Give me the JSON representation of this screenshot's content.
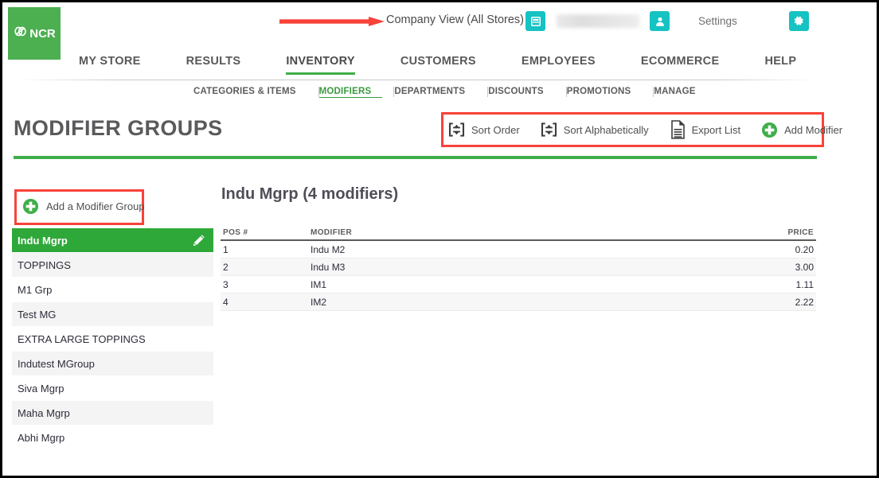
{
  "colors": {
    "brand_green": "#4caf50",
    "rule_green": "#3fae49",
    "selected_green": "#2fa83a",
    "teal": "#16c2c2",
    "annotation_red": "#f9423a",
    "text_gray": "#4a4a4a"
  },
  "header": {
    "logo_text": "NCR",
    "logo_icon": "ncr-link-logo-icon",
    "company_view": "Company View (All Stores)",
    "store_icon": "store-icon",
    "user_icon": "user-profile-icon",
    "user_name": "",
    "settings_label": "Settings",
    "gear_icon": "gear-icon",
    "arrow_annotation": "red-arrow-pointing-right"
  },
  "mainnav": {
    "items": [
      {
        "label": "MY STORE",
        "active": false
      },
      {
        "label": "RESULTS",
        "active": false
      },
      {
        "label": "INVENTORY",
        "active": true
      },
      {
        "label": "CUSTOMERS",
        "active": false
      },
      {
        "label": "EMPLOYEES",
        "active": false
      },
      {
        "label": "ECOMMERCE",
        "active": false
      },
      {
        "label": "HELP",
        "active": false
      }
    ]
  },
  "subnav": {
    "items": [
      {
        "label": "CATEGORIES & ITEMS",
        "active": false
      },
      {
        "label": "MODIFIERS",
        "active": true
      },
      {
        "label": "DEPARTMENTS",
        "active": false
      },
      {
        "label": "DISCOUNTS",
        "active": false
      },
      {
        "label": "PROMOTIONS",
        "active": false
      },
      {
        "label": "MANAGE",
        "active": false
      }
    ]
  },
  "page": {
    "title": "MODIFIER GROUPS"
  },
  "toolbar": {
    "buttons": [
      {
        "label": "Sort Order",
        "icon": "sort-order-icon"
      },
      {
        "label": "Sort Alphabetically",
        "icon": "sort-alphabetically-icon"
      },
      {
        "label": "Export List",
        "icon": "export-document-icon"
      },
      {
        "label": "Add Modifier",
        "icon": "plus-circle-icon"
      }
    ]
  },
  "sidebar": {
    "add_group_label": "Add a Modifier Group",
    "add_group_icon": "plus-circle-icon",
    "edit_icon": "pencil-edit-icon",
    "groups": [
      {
        "label": "Indu Mgrp",
        "selected": true
      },
      {
        "label": "TOPPINGS",
        "selected": false
      },
      {
        "label": "M1 Grp",
        "selected": false
      },
      {
        "label": "Test MG",
        "selected": false
      },
      {
        "label": "EXTRA LARGE TOPPINGS",
        "selected": false
      },
      {
        "label": "Indutest MGroup",
        "selected": false
      },
      {
        "label": "Siva Mgrp",
        "selected": false
      },
      {
        "label": "Maha Mgrp",
        "selected": false
      },
      {
        "label": "Abhi Mgrp",
        "selected": false
      }
    ]
  },
  "content": {
    "title": "Indu Mgrp (4 modifiers)",
    "columns": [
      "POS #",
      "MODIFIER",
      "PRICE"
    ],
    "rows": [
      {
        "pos": "1",
        "modifier": "Indu M2",
        "price": "0.20"
      },
      {
        "pos": "2",
        "modifier": "Indu M3",
        "price": "3.00"
      },
      {
        "pos": "3",
        "modifier": "IM1",
        "price": "1.11"
      },
      {
        "pos": "4",
        "modifier": "IM2",
        "price": "2.22"
      }
    ]
  }
}
